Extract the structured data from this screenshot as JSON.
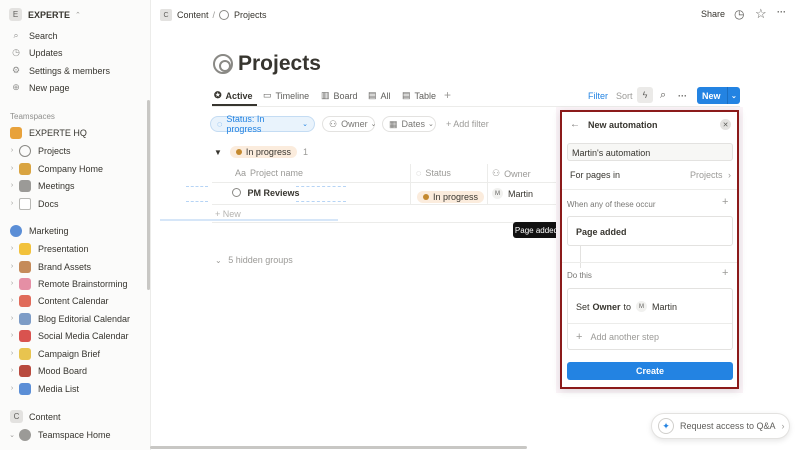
{
  "workspace": {
    "name": "EXPERTE",
    "badge": "E"
  },
  "sidebar": {
    "top_items": [
      {
        "label": "Search",
        "icon": "search-icon",
        "glyph": "⌕"
      },
      {
        "label": "Updates",
        "icon": "clock-icon",
        "glyph": "◷"
      },
      {
        "label": "Settings & members",
        "icon": "gear-icon",
        "glyph": "⚙"
      },
      {
        "label": "New page",
        "icon": "plus-circle-icon",
        "glyph": "⊕"
      }
    ],
    "teamspaces_label": "Teamspaces",
    "experte_hq": "EXPERTE HQ",
    "hq_items": [
      {
        "label": "Projects",
        "color": "#8a8985"
      },
      {
        "label": "Company Home",
        "color": "#d9a441"
      },
      {
        "label": "Meetings",
        "color": "#9b9a97"
      },
      {
        "label": "Docs",
        "color": "#b8b8b5"
      }
    ],
    "marketing": "Marketing",
    "marketing_items": [
      {
        "label": "Presentation",
        "color": "#f2c23c"
      },
      {
        "label": "Brand Assets",
        "color": "#c58b5a"
      },
      {
        "label": "Remote Brainstorming",
        "color": "#e58fa5"
      },
      {
        "label": "Content Calendar",
        "color": "#e06b5a"
      },
      {
        "label": "Blog Editorial Calendar",
        "color": "#7d9cc6"
      },
      {
        "label": "Social Media Calendar",
        "color": "#d9534f"
      },
      {
        "label": "Campaign Brief",
        "color": "#e8c44f"
      },
      {
        "label": "Mood Board",
        "color": "#b84a3e"
      },
      {
        "label": "Media List",
        "color": "#5b8ed6"
      }
    ],
    "content": "Content",
    "content_badge": "C",
    "teamspace_home": "Teamspace Home"
  },
  "topbar": {
    "crumb_badge": "C",
    "crumb_1": "Content",
    "crumb_sep": "/",
    "crumb_2": "Projects",
    "share": "Share",
    "more": "···"
  },
  "page": {
    "title": "Projects"
  },
  "tabs": [
    {
      "label": "Active",
      "glyph": "✪"
    },
    {
      "label": "Timeline",
      "glyph": "▭"
    },
    {
      "label": "Board",
      "glyph": "▥"
    },
    {
      "label": "All",
      "glyph": "▤"
    },
    {
      "label": "Table",
      "glyph": "▤"
    }
  ],
  "toolbar": {
    "filter": "Filter",
    "sort": "Sort",
    "new": "New",
    "more": "···"
  },
  "filters": {
    "status": "Status: In progress",
    "owner": "Owner",
    "dates": "Dates",
    "add": "+ Add filter"
  },
  "group": {
    "label": "In progress",
    "count": "1"
  },
  "columns": {
    "name": "Project name",
    "status": "Status",
    "owner": "Owner"
  },
  "rows": [
    {
      "name": "PM Reviews",
      "status": "In progress",
      "owner": "Martin",
      "owner_initial": "M"
    }
  ],
  "new_row": "+ New",
  "hidden_groups": "5 hidden groups",
  "tooltip": "Page added",
  "automation": {
    "title": "New automation",
    "name_value": "Martin's automation",
    "for_pages": "For pages in",
    "for_pages_value": "Projects",
    "trigger_section": "When any of these occur",
    "trigger": "Page added",
    "action_section": "Do this",
    "action_prefix": "Set",
    "action_field": "Owner",
    "action_to": "to",
    "action_value": "Martin",
    "action_initial": "M",
    "add_step": "Add another step",
    "create": "Create"
  },
  "qa_button": "Request access to Q&A"
}
